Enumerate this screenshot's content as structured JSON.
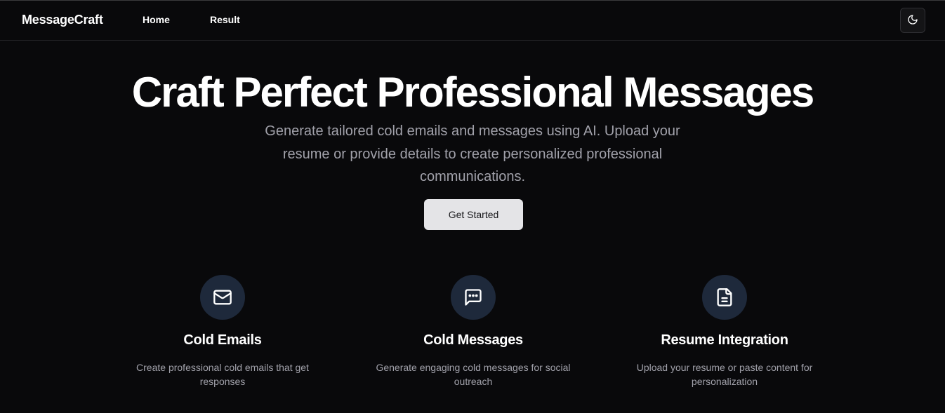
{
  "nav": {
    "brand": "MessageCraft",
    "links": [
      {
        "label": "Home"
      },
      {
        "label": "Result"
      }
    ],
    "theme_toggle_icon": "moon-icon"
  },
  "hero": {
    "title": "Craft Perfect Professional Messages",
    "subtitle": "Generate tailored cold emails and messages using AI. Upload your resume or provide details to create personalized professional communications.",
    "cta_label": "Get Started"
  },
  "features": [
    {
      "icon": "mail-icon",
      "title": "Cold Emails",
      "description": "Create professional cold emails that get responses"
    },
    {
      "icon": "message-square-icon",
      "title": "Cold Messages",
      "description": "Generate engaging cold messages for social outreach"
    },
    {
      "icon": "file-text-icon",
      "title": "Resume Integration",
      "description": "Upload your resume or paste content for personalization"
    }
  ],
  "colors": {
    "background": "#09090b",
    "icon_circle": "#1e293b",
    "cta_bg": "#e4e4e7",
    "muted_text": "#a1a1aa"
  }
}
